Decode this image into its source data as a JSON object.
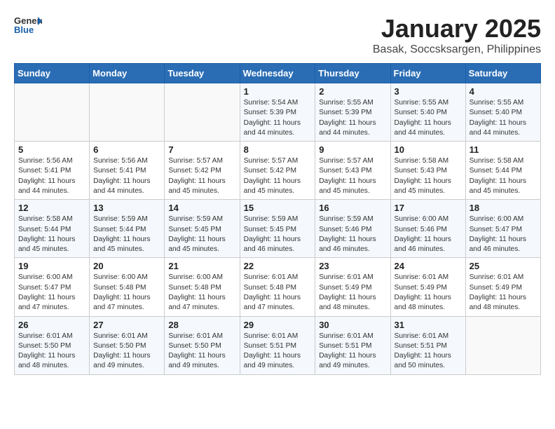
{
  "logo": {
    "general": "General",
    "blue": "Blue"
  },
  "title": "January 2025",
  "subtitle": "Basak, Soccsksargen, Philippines",
  "days_of_week": [
    "Sunday",
    "Monday",
    "Tuesday",
    "Wednesday",
    "Thursday",
    "Friday",
    "Saturday"
  ],
  "weeks": [
    [
      null,
      null,
      null,
      {
        "day": "1",
        "sunrise": "Sunrise: 5:54 AM",
        "sunset": "Sunset: 5:39 PM",
        "daylight": "Daylight: 11 hours and 44 minutes."
      },
      {
        "day": "2",
        "sunrise": "Sunrise: 5:55 AM",
        "sunset": "Sunset: 5:39 PM",
        "daylight": "Daylight: 11 hours and 44 minutes."
      },
      {
        "day": "3",
        "sunrise": "Sunrise: 5:55 AM",
        "sunset": "Sunset: 5:40 PM",
        "daylight": "Daylight: 11 hours and 44 minutes."
      },
      {
        "day": "4",
        "sunrise": "Sunrise: 5:55 AM",
        "sunset": "Sunset: 5:40 PM",
        "daylight": "Daylight: 11 hours and 44 minutes."
      }
    ],
    [
      {
        "day": "5",
        "sunrise": "Sunrise: 5:56 AM",
        "sunset": "Sunset: 5:41 PM",
        "daylight": "Daylight: 11 hours and 44 minutes."
      },
      {
        "day": "6",
        "sunrise": "Sunrise: 5:56 AM",
        "sunset": "Sunset: 5:41 PM",
        "daylight": "Daylight: 11 hours and 44 minutes."
      },
      {
        "day": "7",
        "sunrise": "Sunrise: 5:57 AM",
        "sunset": "Sunset: 5:42 PM",
        "daylight": "Daylight: 11 hours and 45 minutes."
      },
      {
        "day": "8",
        "sunrise": "Sunrise: 5:57 AM",
        "sunset": "Sunset: 5:42 PM",
        "daylight": "Daylight: 11 hours and 45 minutes."
      },
      {
        "day": "9",
        "sunrise": "Sunrise: 5:57 AM",
        "sunset": "Sunset: 5:43 PM",
        "daylight": "Daylight: 11 hours and 45 minutes."
      },
      {
        "day": "10",
        "sunrise": "Sunrise: 5:58 AM",
        "sunset": "Sunset: 5:43 PM",
        "daylight": "Daylight: 11 hours and 45 minutes."
      },
      {
        "day": "11",
        "sunrise": "Sunrise: 5:58 AM",
        "sunset": "Sunset: 5:44 PM",
        "daylight": "Daylight: 11 hours and 45 minutes."
      }
    ],
    [
      {
        "day": "12",
        "sunrise": "Sunrise: 5:58 AM",
        "sunset": "Sunset: 5:44 PM",
        "daylight": "Daylight: 11 hours and 45 minutes."
      },
      {
        "day": "13",
        "sunrise": "Sunrise: 5:59 AM",
        "sunset": "Sunset: 5:44 PM",
        "daylight": "Daylight: 11 hours and 45 minutes."
      },
      {
        "day": "14",
        "sunrise": "Sunrise: 5:59 AM",
        "sunset": "Sunset: 5:45 PM",
        "daylight": "Daylight: 11 hours and 45 minutes."
      },
      {
        "day": "15",
        "sunrise": "Sunrise: 5:59 AM",
        "sunset": "Sunset: 5:45 PM",
        "daylight": "Daylight: 11 hours and 46 minutes."
      },
      {
        "day": "16",
        "sunrise": "Sunrise: 5:59 AM",
        "sunset": "Sunset: 5:46 PM",
        "daylight": "Daylight: 11 hours and 46 minutes."
      },
      {
        "day": "17",
        "sunrise": "Sunrise: 6:00 AM",
        "sunset": "Sunset: 5:46 PM",
        "daylight": "Daylight: 11 hours and 46 minutes."
      },
      {
        "day": "18",
        "sunrise": "Sunrise: 6:00 AM",
        "sunset": "Sunset: 5:47 PM",
        "daylight": "Daylight: 11 hours and 46 minutes."
      }
    ],
    [
      {
        "day": "19",
        "sunrise": "Sunrise: 6:00 AM",
        "sunset": "Sunset: 5:47 PM",
        "daylight": "Daylight: 11 hours and 47 minutes."
      },
      {
        "day": "20",
        "sunrise": "Sunrise: 6:00 AM",
        "sunset": "Sunset: 5:48 PM",
        "daylight": "Daylight: 11 hours and 47 minutes."
      },
      {
        "day": "21",
        "sunrise": "Sunrise: 6:00 AM",
        "sunset": "Sunset: 5:48 PM",
        "daylight": "Daylight: 11 hours and 47 minutes."
      },
      {
        "day": "22",
        "sunrise": "Sunrise: 6:01 AM",
        "sunset": "Sunset: 5:48 PM",
        "daylight": "Daylight: 11 hours and 47 minutes."
      },
      {
        "day": "23",
        "sunrise": "Sunrise: 6:01 AM",
        "sunset": "Sunset: 5:49 PM",
        "daylight": "Daylight: 11 hours and 48 minutes."
      },
      {
        "day": "24",
        "sunrise": "Sunrise: 6:01 AM",
        "sunset": "Sunset: 5:49 PM",
        "daylight": "Daylight: 11 hours and 48 minutes."
      },
      {
        "day": "25",
        "sunrise": "Sunrise: 6:01 AM",
        "sunset": "Sunset: 5:49 PM",
        "daylight": "Daylight: 11 hours and 48 minutes."
      }
    ],
    [
      {
        "day": "26",
        "sunrise": "Sunrise: 6:01 AM",
        "sunset": "Sunset: 5:50 PM",
        "daylight": "Daylight: 11 hours and 48 minutes."
      },
      {
        "day": "27",
        "sunrise": "Sunrise: 6:01 AM",
        "sunset": "Sunset: 5:50 PM",
        "daylight": "Daylight: 11 hours and 49 minutes."
      },
      {
        "day": "28",
        "sunrise": "Sunrise: 6:01 AM",
        "sunset": "Sunset: 5:50 PM",
        "daylight": "Daylight: 11 hours and 49 minutes."
      },
      {
        "day": "29",
        "sunrise": "Sunrise: 6:01 AM",
        "sunset": "Sunset: 5:51 PM",
        "daylight": "Daylight: 11 hours and 49 minutes."
      },
      {
        "day": "30",
        "sunrise": "Sunrise: 6:01 AM",
        "sunset": "Sunset: 5:51 PM",
        "daylight": "Daylight: 11 hours and 49 minutes."
      },
      {
        "day": "31",
        "sunrise": "Sunrise: 6:01 AM",
        "sunset": "Sunset: 5:51 PM",
        "daylight": "Daylight: 11 hours and 50 minutes."
      },
      null
    ]
  ]
}
